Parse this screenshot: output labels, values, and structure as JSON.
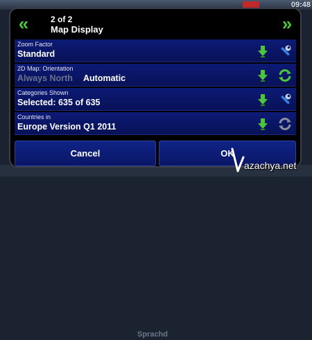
{
  "status": {
    "time": "09:48"
  },
  "background": {
    "bottom_text": "Sprachd"
  },
  "header": {
    "prev_icon": "double-chevron-left",
    "next_icon": "double-chevron-right",
    "page": "2 of 2",
    "title": "Map Display"
  },
  "rows": [
    {
      "label": "Zoom Factor",
      "value": "Standard",
      "icons": [
        "download-arrow",
        "wrench"
      ]
    },
    {
      "label": "2D Map: Orientation",
      "value_dim": "Always North",
      "value": "Automatic",
      "icons": [
        "download-arrow",
        "cycle-arrows-green"
      ]
    },
    {
      "label": "Categories Shown",
      "value": "Selected: 635 of 635",
      "icons": [
        "download-arrow",
        "wrench"
      ]
    },
    {
      "label": "Countries in",
      "value": "Europe Version Q1 2011",
      "icons": [
        "download-arrow",
        "cycle-arrows-gray"
      ]
    }
  ],
  "buttons": {
    "cancel": "Cancel",
    "ok": "OK"
  },
  "watermark": {
    "text": "azachya.net"
  },
  "colors": {
    "accent_green": "#4cc63a",
    "row_blue": "#0c1a75",
    "wrench_blue": "#3b7fe0"
  }
}
